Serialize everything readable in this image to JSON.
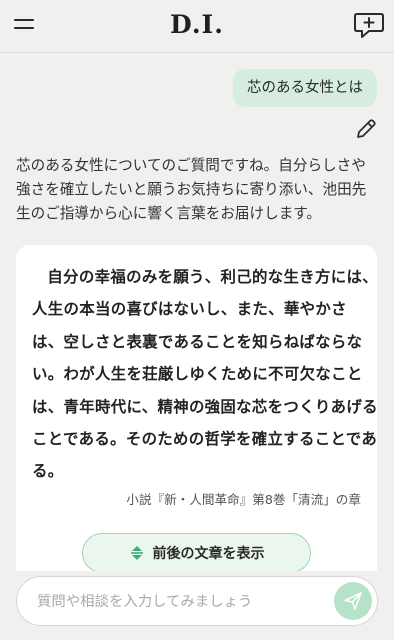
{
  "header": {
    "logo": "D.I.",
    "menu_icon": "hamburger-menu-icon",
    "new_chat_icon": "chat-plus-icon"
  },
  "conversation": {
    "user_message": "芯のある女性とは",
    "edit_icon": "pencil-icon",
    "assistant_intro": "芯のある女性についてのご質問ですね。自分らしさや強さを確立したいと願うお気持ちに寄り添い、池田先生のご指導から心に響く言葉をお届けします。",
    "quote_card": {
      "quote": "自分の幸福のみを願う、利己的な生き方には、人生の本当の喜びはないし、また、華やかさは、空しさと表裏であることを知らねばならない。わが人生を荘厳しゆくために不可欠なことは、青年時代に、精神の強固な芯をつくりあげることである。そのための哲学を確立することである。",
      "source": "小説『新・人間革命』第8巻「清流」の章",
      "context_button_label": "前後の文章を表示",
      "context_icon": "expand-arrows-icon"
    }
  },
  "composer": {
    "placeholder": "質問や相談を入力してみましょう",
    "value": "",
    "send_icon": "paper-plane-send-icon"
  },
  "colors": {
    "background": "#f0f0ee",
    "user_bubble": "#d5ecdf",
    "accent_green": "#9ed3b5",
    "send_button": "#b6e2c8",
    "card": "#ffffff"
  }
}
